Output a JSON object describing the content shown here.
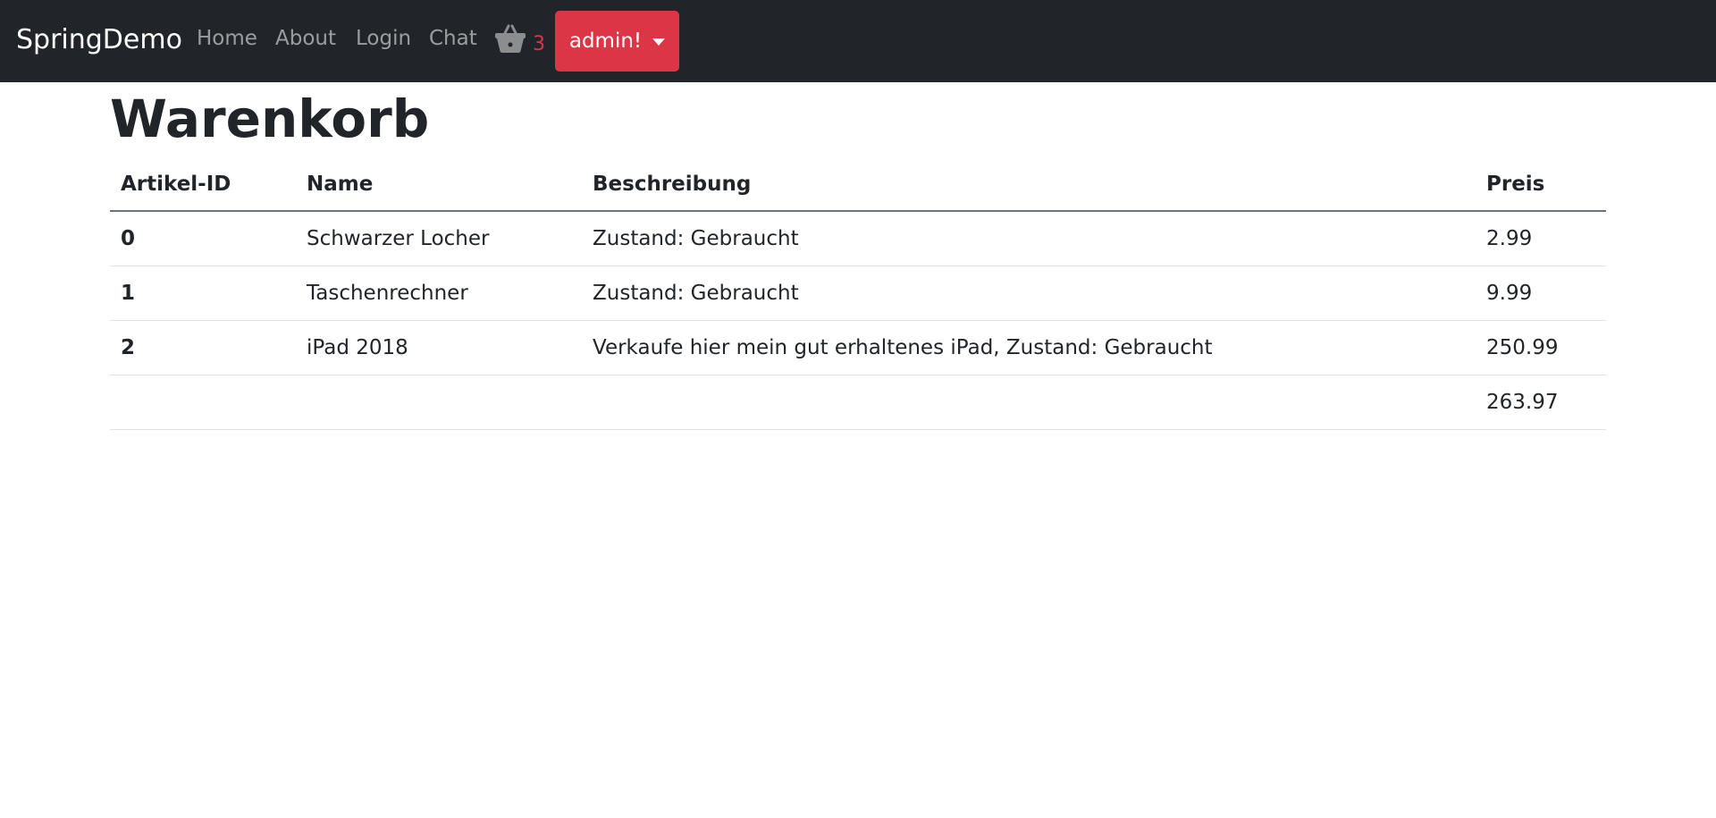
{
  "navbar": {
    "brand": "SpringDemo",
    "links": [
      "Home",
      "About",
      "Login",
      "Chat"
    ],
    "cart_count": "3",
    "user_label": "admin!"
  },
  "page": {
    "title": "Warenkorb"
  },
  "table": {
    "headers": [
      "Artikel-ID",
      "Name",
      "Beschreibung",
      "Preis"
    ],
    "rows": [
      {
        "id": "0",
        "name": "Schwarzer Locher",
        "description": "Zustand: Gebraucht",
        "price": "2.99"
      },
      {
        "id": "1",
        "name": "Taschenrechner",
        "description": "Zustand: Gebraucht",
        "price": "9.99"
      },
      {
        "id": "2",
        "name": "iPad 2018",
        "description": "Verkaufe hier mein gut erhaltenes iPad, Zustand: Gebraucht",
        "price": "250.99"
      }
    ],
    "total": "263.97"
  },
  "colors": {
    "navbar_bg": "#212529",
    "danger": "#dc3545",
    "nav_link": "#8b8d8f"
  },
  "icons": {
    "cart": "shopping-basket-icon",
    "dropdown": "caret-down-icon"
  }
}
